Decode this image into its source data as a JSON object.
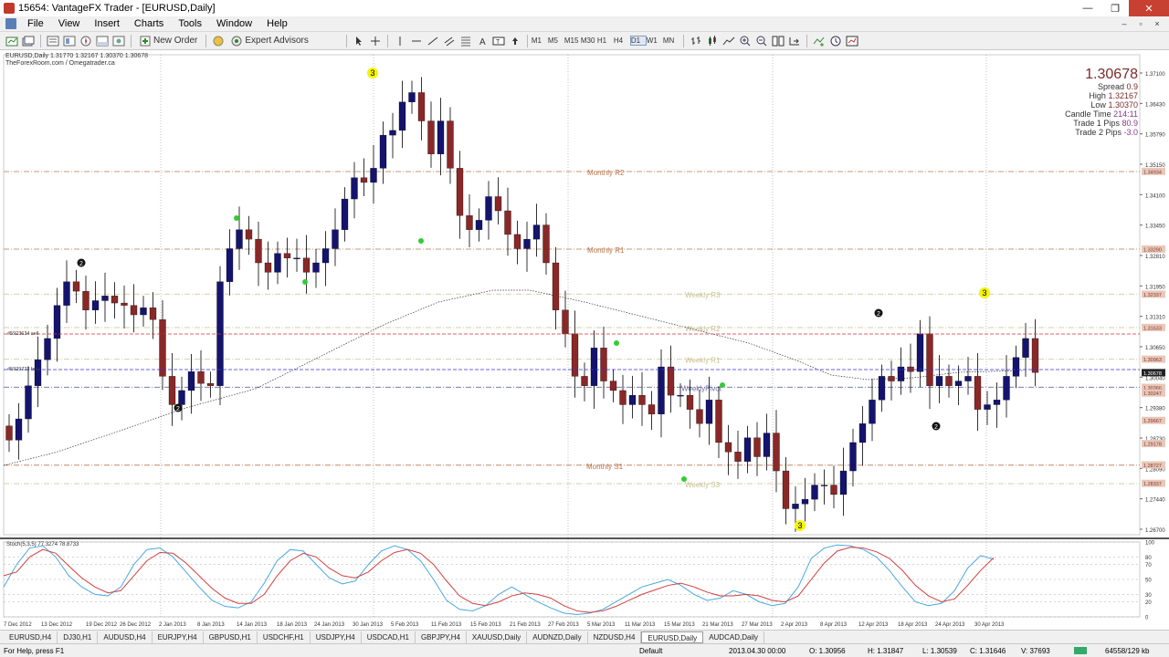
{
  "window": {
    "title": "15654: VantageFX Trader - [EURUSD,Daily]",
    "minimize": "—",
    "maximize": "❐",
    "close": "✕"
  },
  "menu": {
    "items": [
      "File",
      "View",
      "Insert",
      "Charts",
      "Tools",
      "Window",
      "Help"
    ],
    "mdi_min": "–",
    "mdi_restore": "▫",
    "mdi_close": "×"
  },
  "toolbar": {
    "new_order": "New Order",
    "expert_advisors": "Expert Advisors",
    "timeframes": [
      "M1",
      "M5",
      "M15",
      "M30",
      "H1",
      "H4",
      "D1",
      "W1",
      "MN"
    ],
    "active_timeframe": "D1"
  },
  "chart_header": {
    "line1": "EURUSD,Daily  1.31770 1.32167 1.30370 1.30678",
    "line2": "TheForexRoom.com / Omegatrader.ca"
  },
  "info_panel": {
    "price": "1.30678",
    "spread_label": "Spread",
    "spread_value": "0.9",
    "high_label": "High",
    "high_value": "1.32167",
    "low_label": "Low",
    "low_value": "1.30370",
    "candle_label": "Candle Time",
    "candle_value": "214:11",
    "trade1_label": "Trade 1 Pips",
    "trade1_value": "80.9",
    "trade2_label": "Trade 2 Pips",
    "trade2_value": "-3.0"
  },
  "chart_data": {
    "type": "candlestick",
    "symbol": "EURUSD",
    "timeframe": "Daily",
    "ylim": [
      1.2725,
      1.374
    ],
    "y_ticks": [
      "1.37100",
      "1.36430",
      "1.35790",
      "1.35150",
      "1.34100",
      "1.33450",
      "1.32810",
      "1.31950",
      "1.31310",
      "1.30650",
      "1.30040",
      "1.29380",
      "1.28730",
      "1.28090",
      "1.27440",
      "1.26700"
    ],
    "x_labels": [
      "7 Dec 2012",
      "13 Dec 2012",
      "19 Dec 2012",
      "26 Dec 2012",
      "2 Jan 2013",
      "8 Jan 2013",
      "14 Jan 2013",
      "18 Jan 2013",
      "24 Jan 2013",
      "30 Jan 2013",
      "5 Feb 2013",
      "11 Feb 2013",
      "15 Feb 2013",
      "21 Feb 2013",
      "27 Feb 2013",
      "5 Mar 2013",
      "11 Mar 2013",
      "15 Mar 2013",
      "21 Mar 2013",
      "27 Mar 2013",
      "2 Apr 2013",
      "8 Apr 2013",
      "12 Apr 2013",
      "18 Apr 2013",
      "24 Apr 2013",
      "30 Apr 2013"
    ],
    "candles_close": [
      1.2925,
      1.297,
      1.304,
      1.3095,
      1.314,
      1.321,
      1.326,
      1.324,
      1.32,
      1.322,
      1.323,
      1.3215,
      1.321,
      1.319,
      1.3205,
      1.318,
      1.306,
      1.3,
      1.303,
      1.307,
      1.3045,
      1.304,
      1.326,
      1.333,
      1.337,
      1.335,
      1.33,
      1.328,
      1.332,
      1.331,
      1.331,
      1.328,
      1.33,
      1.333,
      1.337,
      1.3435,
      1.348,
      1.347,
      1.35,
      1.357,
      1.358,
      1.364,
      1.366,
      1.36,
      1.353,
      1.36,
      1.35,
      1.34,
      1.337,
      1.339,
      1.344,
      1.341,
      1.336,
      1.333,
      1.335,
      1.338,
      1.33,
      1.32,
      1.315,
      1.306,
      1.304,
      1.312,
      1.305,
      1.303,
      1.3,
      1.302,
      1.3,
      1.298,
      1.308,
      1.302,
      1.302,
      1.299,
      1.296,
      1.301,
      1.292,
      1.29,
      1.288,
      1.293,
      1.289,
      1.294,
      1.286,
      1.278,
      1.279,
      1.28,
      1.283,
      1.283,
      1.281,
      1.286,
      1.292,
      1.296,
      1.301,
      1.306,
      1.305,
      1.308,
      1.307,
      1.315,
      1.304,
      1.306,
      1.304,
      1.305,
      1.306,
      1.299,
      1.3,
      1.301,
      1.306,
      1.31,
      1.314,
      1.3068
    ],
    "pivot_levels": [
      {
        "name": "Monthly R2",
        "value": 1.3493,
        "color": "#b87850"
      },
      {
        "name": "Monthly R1",
        "value": 1.3329,
        "color": "#b87850"
      },
      {
        "name": "Weekly R3",
        "value": 1.3234,
        "color": "#c8c090"
      },
      {
        "name": "Weekly R2",
        "value": 1.3163,
        "color": "#c8c090"
      },
      {
        "name": "Weekly R1",
        "value": 1.3096,
        "color": "#c8c090"
      },
      {
        "name": "WeeklyPivot",
        "value": 1.3037,
        "color": "#6a6aa0"
      },
      {
        "name": "Monthly S1",
        "value": 1.2872,
        "color": "#b87850"
      },
      {
        "name": "Weekly S3",
        "value": 1.2833,
        "color": "#c8c090"
      }
    ],
    "price_tags": [
      "1.34934",
      "1.33290",
      "1.32337",
      "1.31633",
      "1.30963",
      "1.30678",
      "1.30366",
      "1.30247",
      "1.29667",
      "1.29178",
      "1.28727",
      "1.28337"
    ],
    "order_labels": [
      "#5923634 sell",
      "#5929723 buy"
    ],
    "wave_marks": [
      "3",
      "2",
      "2",
      "3",
      "2",
      "3",
      "2"
    ],
    "oscillator": {
      "label": "Stoch(5,3,5) 77.3274 78.8733",
      "ticks": [
        "100",
        "80",
        "70",
        "50",
        "30",
        "20",
        "0"
      ],
      "k": [
        40,
        70,
        92,
        95,
        80,
        55,
        40,
        30,
        28,
        40,
        70,
        90,
        92,
        80,
        60,
        40,
        22,
        14,
        12,
        20,
        45,
        75,
        90,
        88,
        70,
        52,
        44,
        48,
        70,
        88,
        95,
        90,
        75,
        50,
        22,
        10,
        8,
        15,
        30,
        40,
        30,
        20,
        12,
        5,
        3,
        5,
        10,
        20,
        30,
        40,
        45,
        50,
        42,
        30,
        22,
        25,
        35,
        30,
        20,
        15,
        18,
        40,
        78,
        92,
        96,
        95,
        90,
        80,
        62,
        40,
        20,
        15,
        18,
        35,
        65,
        82,
        77
      ],
      "d": [
        55,
        60,
        80,
        90,
        85,
        68,
        52,
        40,
        32,
        35,
        55,
        75,
        86,
        85,
        72,
        55,
        38,
        25,
        18,
        18,
        30,
        55,
        75,
        85,
        80,
        65,
        55,
        52,
        60,
        75,
        86,
        90,
        85,
        70,
        48,
        28,
        18,
        15,
        20,
        28,
        32,
        30,
        25,
        15,
        8,
        6,
        8,
        14,
        22,
        30,
        36,
        42,
        45,
        40,
        33,
        28,
        28,
        30,
        28,
        22,
        20,
        28,
        50,
        72,
        88,
        93,
        92,
        87,
        78,
        62,
        42,
        28,
        20,
        24,
        42,
        62,
        79
      ]
    }
  },
  "tabs": [
    "EURUSD,H4",
    "DJ30,H1",
    "AUDUSD,H4",
    "EURJPY,H4",
    "GBPUSD,H1",
    "USDCHF,H1",
    "USDJPY,H4",
    "USDCAD,H1",
    "GBPJPY,H4",
    "XAUUSD,Daily",
    "AUDNZD,Daily",
    "NZDUSD,H4",
    "EURUSD,Daily",
    "AUDCAD,Daily"
  ],
  "active_tab": "EURUSD,Daily",
  "status": {
    "help": "For Help, press F1",
    "profile": "Default",
    "datetime": "2013.04.30 00:00",
    "open": "O: 1.30956",
    "high": "H: 1.31847",
    "low": "L: 1.30539",
    "close": "C: 1.31646",
    "volume": "V: 37693",
    "traffic": "64558/129 kb"
  }
}
